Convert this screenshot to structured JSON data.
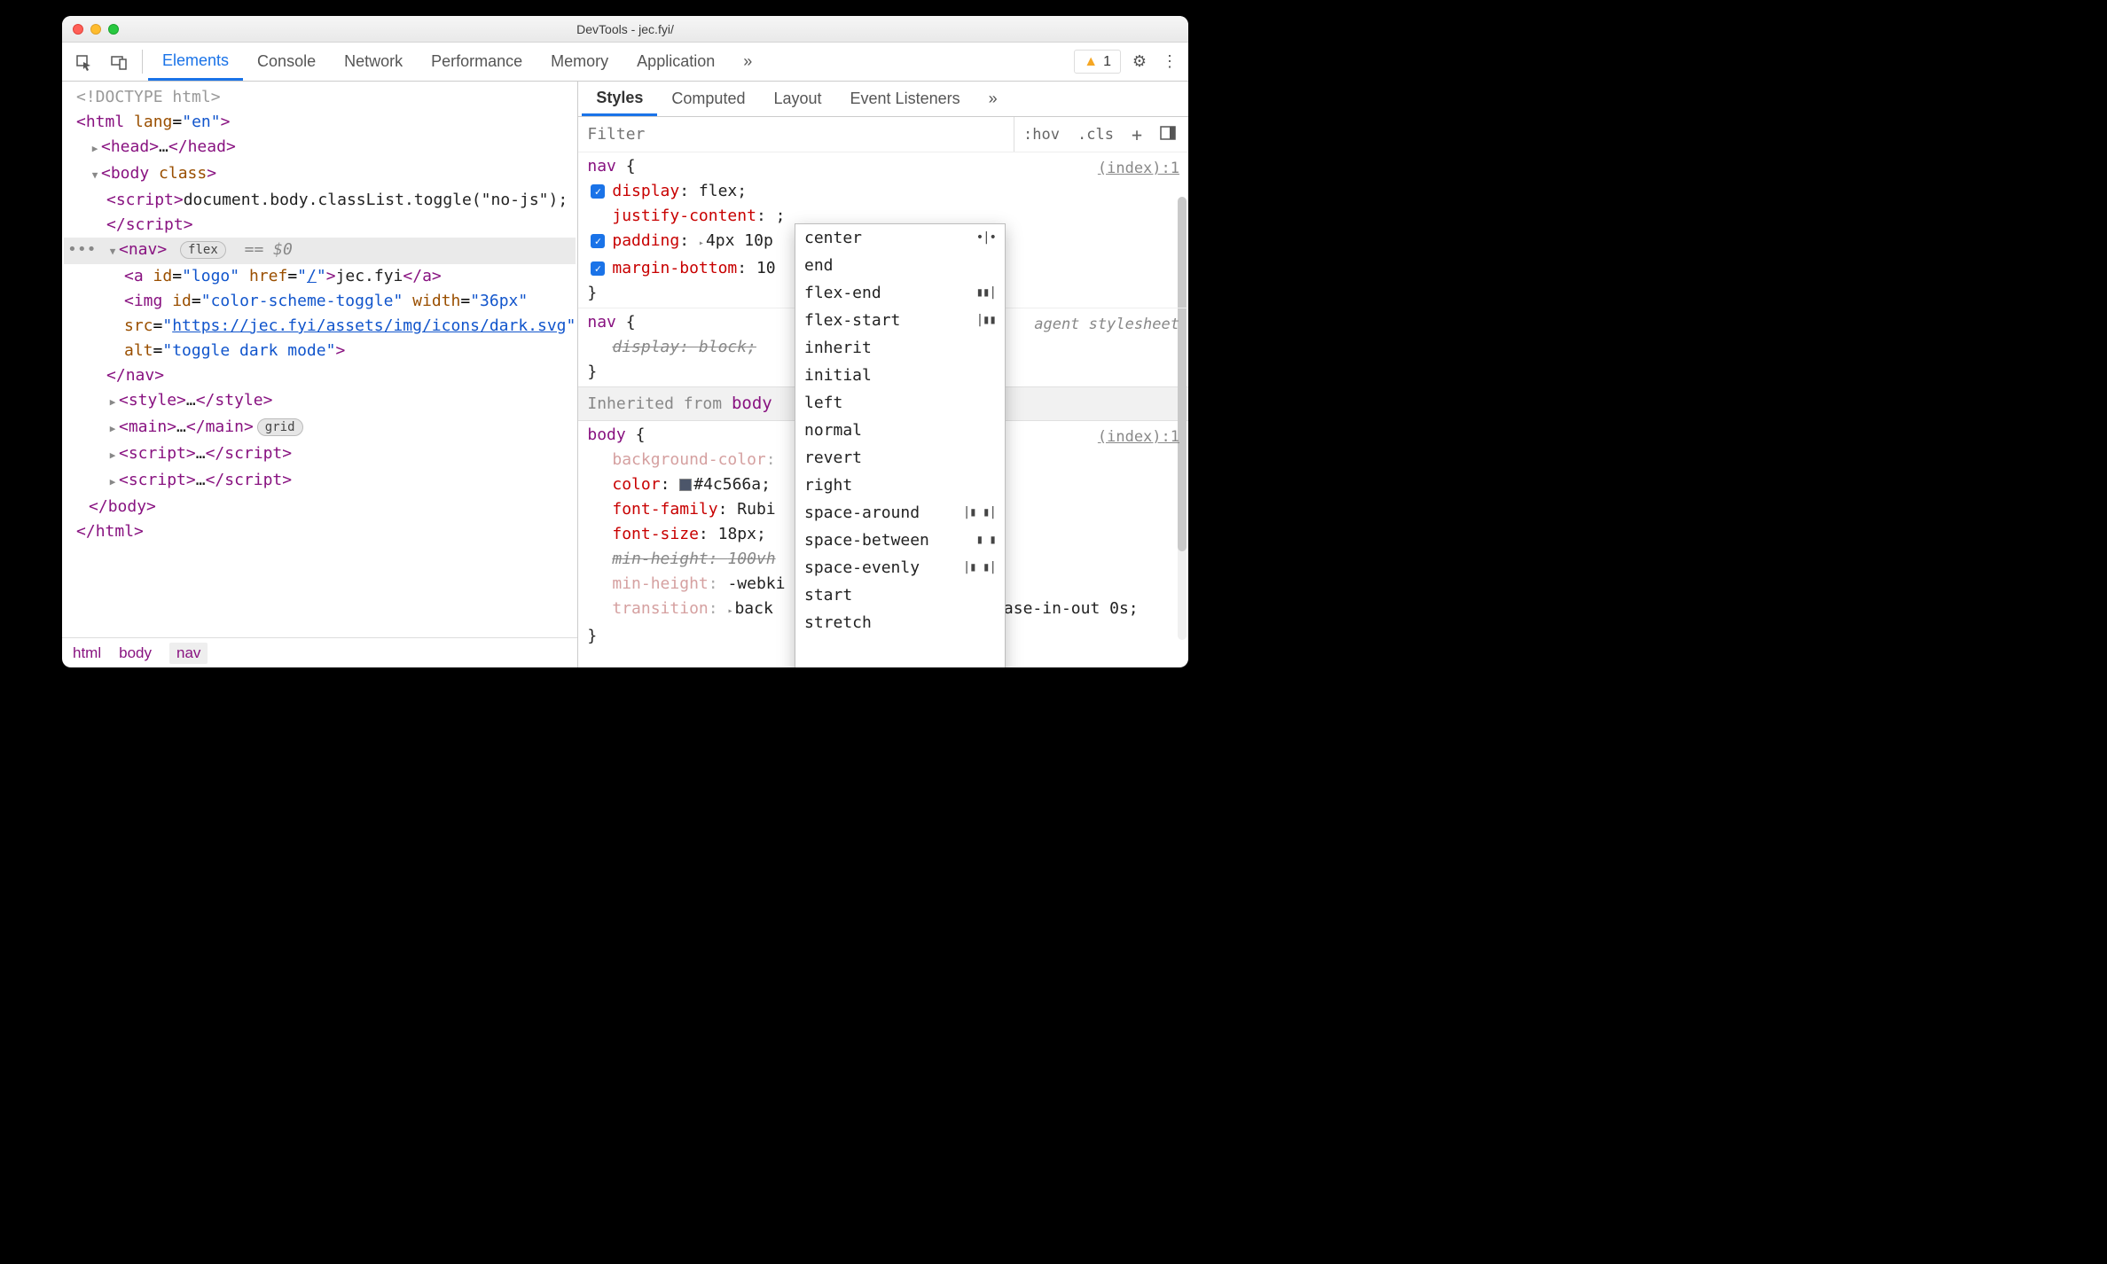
{
  "window": {
    "title": "DevTools - jec.fyi/"
  },
  "toolbar": {
    "tabs": [
      "Elements",
      "Console",
      "Network",
      "Performance",
      "Memory",
      "Application"
    ],
    "active_tab": "Elements",
    "overflow_glyph": "»",
    "warning_count": "1"
  },
  "dom": {
    "doctype": "<!DOCTYPE html>",
    "html_open": {
      "tag": "html",
      "attr": "lang",
      "val": "en"
    },
    "head": {
      "tag": "head",
      "ellipsis": "…"
    },
    "body_open": {
      "tag": "body",
      "attr": "class"
    },
    "script_inline": {
      "tag": "script",
      "text": "document.body.classList.toggle(\"no-js\");"
    },
    "nav": {
      "tag": "nav",
      "pill": "flex",
      "eq": "== $0"
    },
    "a_logo": {
      "tag": "a",
      "id_attr": "id",
      "id_val": "logo",
      "href_attr": "href",
      "href_val": "/",
      "text": "jec.fyi"
    },
    "img": {
      "tag": "img",
      "id_attr": "id",
      "id_val": "color-scheme-toggle",
      "width_attr": "width",
      "width_val": "36px",
      "src_attr": "src",
      "src_val": "https://jec.fyi/assets/img/icons/dark.svg",
      "alt_attr": "alt",
      "alt_val": "toggle dark mode"
    },
    "nav_close": "nav",
    "style_row": {
      "tag": "style",
      "ellipsis": "…"
    },
    "main_row": {
      "tag": "main",
      "ellipsis": "…",
      "pill": "grid"
    },
    "script_row": {
      "tag": "script",
      "ellipsis": "…"
    },
    "body_close": "body",
    "html_close": "html"
  },
  "breadcrumbs": [
    "html",
    "body",
    "nav"
  ],
  "styles_panel": {
    "tabs": [
      "Styles",
      "Computed",
      "Layout",
      "Event Listeners"
    ],
    "active_tab": "Styles",
    "overflow_glyph": "»",
    "filter_placeholder": "Filter",
    "buttons": {
      "hov": ":hov",
      "cls": ".cls",
      "plus": "+"
    }
  },
  "rules": {
    "nav_index": {
      "selector": "nav",
      "source": "(index):1",
      "props": {
        "display": {
          "name": "display",
          "value": "flex;"
        },
        "justify": {
          "name": "justify-content",
          "value": ";"
        },
        "padding": {
          "name": "padding",
          "expand": "▸",
          "value": "4px 10p"
        },
        "margin": {
          "name": "margin-bottom",
          "value": "10"
        }
      }
    },
    "nav_ua": {
      "selector": "nav",
      "source": "agent stylesheet",
      "prop": {
        "name": "display",
        "value": "block;"
      }
    },
    "inherited_label": "Inherited from",
    "inherited_from": "body",
    "body_rule": {
      "selector": "body",
      "source": "(index):1",
      "props": {
        "bg": {
          "name": "background-color"
        },
        "color": {
          "name": "color",
          "value": "#4c566a;"
        },
        "ff": {
          "name": "font-family",
          "value": "Rubi"
        },
        "fs": {
          "name": "font-size",
          "value": "18px;"
        },
        "mh_strike": {
          "name": "min-height",
          "value": "100vh"
        },
        "mh": {
          "name": "min-height",
          "value": "-webki"
        },
        "tr": {
          "name": "transition",
          "expand": "▸",
          "value": "back",
          "tail": "ase-in-out 0s;"
        }
      }
    }
  },
  "autocomplete": {
    "options": [
      {
        "label": "center",
        "glyph": "•|•"
      },
      {
        "label": "end"
      },
      {
        "label": "flex-end",
        "glyph": "▮▮|"
      },
      {
        "label": "flex-start",
        "glyph": "|▮▮"
      },
      {
        "label": "inherit"
      },
      {
        "label": "initial"
      },
      {
        "label": "left"
      },
      {
        "label": "normal"
      },
      {
        "label": "revert"
      },
      {
        "label": "right"
      },
      {
        "label": "space-around",
        "glyph": "|▮ ▮|"
      },
      {
        "label": "space-between",
        "glyph": "▮   ▮"
      },
      {
        "label": "space-evenly",
        "glyph": "|▮ ▮|"
      },
      {
        "label": "start"
      },
      {
        "label": "stretch"
      }
    ]
  }
}
